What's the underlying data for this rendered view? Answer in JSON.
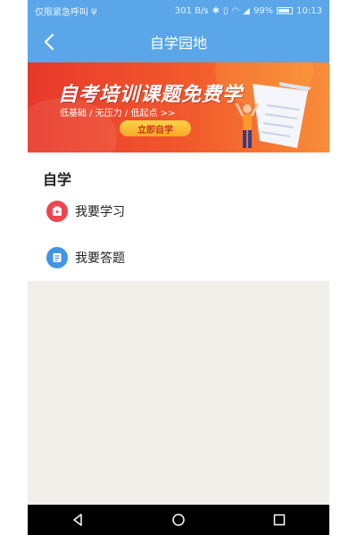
{
  "status_bar": {
    "left_text": "仅限紧急呼叫",
    "network_speed": "301 B/s",
    "battery": "99%",
    "time": "10:13"
  },
  "header": {
    "title": "自学园地"
  },
  "banner": {
    "headline": "自考培训课题免费学",
    "subtitle": "低基础 / 无压力 / 低起点 >>",
    "button_label": "立即自学"
  },
  "section": {
    "title": "自学",
    "items": [
      {
        "label": "我要学习",
        "icon": "play-video-icon",
        "color": "#ef4550"
      },
      {
        "label": "我要答题",
        "icon": "answer-sheet-icon",
        "color": "#3f96e3"
      }
    ]
  },
  "colors": {
    "header_bg": "#5aa6e9",
    "banner_start": "#e8382c",
    "page_bg": "#f0efea"
  }
}
